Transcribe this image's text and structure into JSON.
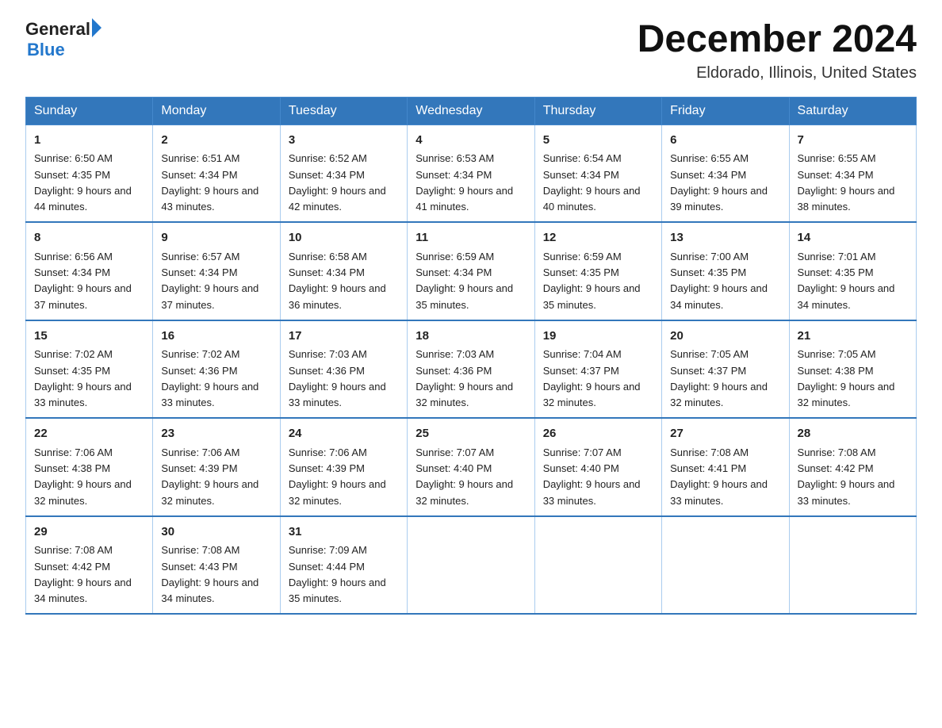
{
  "header": {
    "logo_general": "General",
    "logo_blue": "Blue",
    "month_title": "December 2024",
    "location": "Eldorado, Illinois, United States"
  },
  "weekdays": [
    "Sunday",
    "Monday",
    "Tuesday",
    "Wednesday",
    "Thursday",
    "Friday",
    "Saturday"
  ],
  "weeks": [
    [
      {
        "day": "1",
        "sunrise": "6:50 AM",
        "sunset": "4:35 PM",
        "daylight": "9 hours and 44 minutes."
      },
      {
        "day": "2",
        "sunrise": "6:51 AM",
        "sunset": "4:34 PM",
        "daylight": "9 hours and 43 minutes."
      },
      {
        "day": "3",
        "sunrise": "6:52 AM",
        "sunset": "4:34 PM",
        "daylight": "9 hours and 42 minutes."
      },
      {
        "day": "4",
        "sunrise": "6:53 AM",
        "sunset": "4:34 PM",
        "daylight": "9 hours and 41 minutes."
      },
      {
        "day": "5",
        "sunrise": "6:54 AM",
        "sunset": "4:34 PM",
        "daylight": "9 hours and 40 minutes."
      },
      {
        "day": "6",
        "sunrise": "6:55 AM",
        "sunset": "4:34 PM",
        "daylight": "9 hours and 39 minutes."
      },
      {
        "day": "7",
        "sunrise": "6:55 AM",
        "sunset": "4:34 PM",
        "daylight": "9 hours and 38 minutes."
      }
    ],
    [
      {
        "day": "8",
        "sunrise": "6:56 AM",
        "sunset": "4:34 PM",
        "daylight": "9 hours and 37 minutes."
      },
      {
        "day": "9",
        "sunrise": "6:57 AM",
        "sunset": "4:34 PM",
        "daylight": "9 hours and 37 minutes."
      },
      {
        "day": "10",
        "sunrise": "6:58 AM",
        "sunset": "4:34 PM",
        "daylight": "9 hours and 36 minutes."
      },
      {
        "day": "11",
        "sunrise": "6:59 AM",
        "sunset": "4:34 PM",
        "daylight": "9 hours and 35 minutes."
      },
      {
        "day": "12",
        "sunrise": "6:59 AM",
        "sunset": "4:35 PM",
        "daylight": "9 hours and 35 minutes."
      },
      {
        "day": "13",
        "sunrise": "7:00 AM",
        "sunset": "4:35 PM",
        "daylight": "9 hours and 34 minutes."
      },
      {
        "day": "14",
        "sunrise": "7:01 AM",
        "sunset": "4:35 PM",
        "daylight": "9 hours and 34 minutes."
      }
    ],
    [
      {
        "day": "15",
        "sunrise": "7:02 AM",
        "sunset": "4:35 PM",
        "daylight": "9 hours and 33 minutes."
      },
      {
        "day": "16",
        "sunrise": "7:02 AM",
        "sunset": "4:36 PM",
        "daylight": "9 hours and 33 minutes."
      },
      {
        "day": "17",
        "sunrise": "7:03 AM",
        "sunset": "4:36 PM",
        "daylight": "9 hours and 33 minutes."
      },
      {
        "day": "18",
        "sunrise": "7:03 AM",
        "sunset": "4:36 PM",
        "daylight": "9 hours and 32 minutes."
      },
      {
        "day": "19",
        "sunrise": "7:04 AM",
        "sunset": "4:37 PM",
        "daylight": "9 hours and 32 minutes."
      },
      {
        "day": "20",
        "sunrise": "7:05 AM",
        "sunset": "4:37 PM",
        "daylight": "9 hours and 32 minutes."
      },
      {
        "day": "21",
        "sunrise": "7:05 AM",
        "sunset": "4:38 PM",
        "daylight": "9 hours and 32 minutes."
      }
    ],
    [
      {
        "day": "22",
        "sunrise": "7:06 AM",
        "sunset": "4:38 PM",
        "daylight": "9 hours and 32 minutes."
      },
      {
        "day": "23",
        "sunrise": "7:06 AM",
        "sunset": "4:39 PM",
        "daylight": "9 hours and 32 minutes."
      },
      {
        "day": "24",
        "sunrise": "7:06 AM",
        "sunset": "4:39 PM",
        "daylight": "9 hours and 32 minutes."
      },
      {
        "day": "25",
        "sunrise": "7:07 AM",
        "sunset": "4:40 PM",
        "daylight": "9 hours and 32 minutes."
      },
      {
        "day": "26",
        "sunrise": "7:07 AM",
        "sunset": "4:40 PM",
        "daylight": "9 hours and 33 minutes."
      },
      {
        "day": "27",
        "sunrise": "7:08 AM",
        "sunset": "4:41 PM",
        "daylight": "9 hours and 33 minutes."
      },
      {
        "day": "28",
        "sunrise": "7:08 AM",
        "sunset": "4:42 PM",
        "daylight": "9 hours and 33 minutes."
      }
    ],
    [
      {
        "day": "29",
        "sunrise": "7:08 AM",
        "sunset": "4:42 PM",
        "daylight": "9 hours and 34 minutes."
      },
      {
        "day": "30",
        "sunrise": "7:08 AM",
        "sunset": "4:43 PM",
        "daylight": "9 hours and 34 minutes."
      },
      {
        "day": "31",
        "sunrise": "7:09 AM",
        "sunset": "4:44 PM",
        "daylight": "9 hours and 35 minutes."
      },
      null,
      null,
      null,
      null
    ]
  ]
}
